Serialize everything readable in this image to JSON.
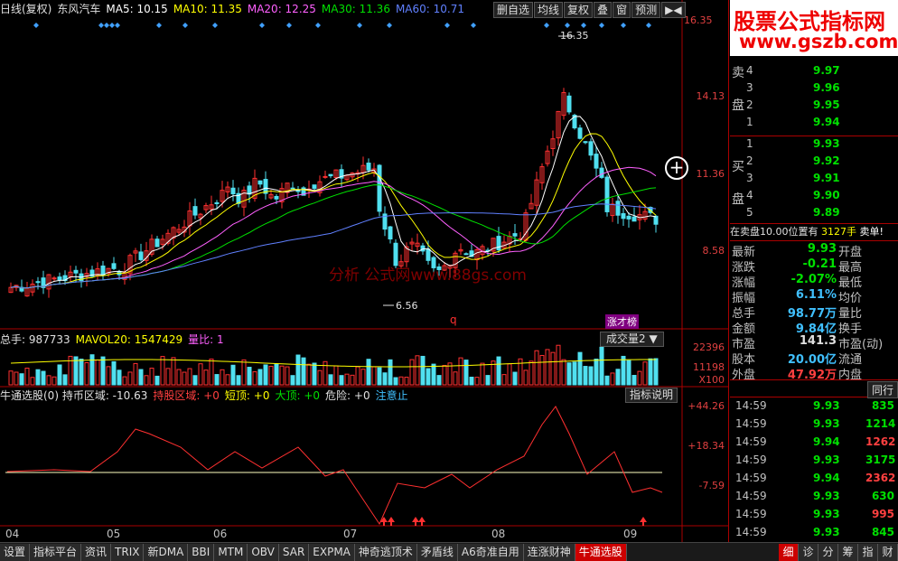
{
  "header": {
    "period": "日线(复权)",
    "stock_name": "东风汽车",
    "ma5": "MA5: 10.15",
    "ma10": "MA10: 11.35",
    "ma20": "MA20: 12.25",
    "ma30": "MA30: 11.36",
    "ma60": "MA60: 10.71"
  },
  "toolbar": [
    "删自选",
    "均线",
    "复权",
    "叠",
    "窗",
    "预测"
  ],
  "price_axis": [
    "16.35",
    "14.13",
    "11.36",
    "8.58"
  ],
  "annotations": {
    "high": "16.35",
    "low": "6.56",
    "watermark": "分析 公式网www.88gs.com",
    "zhangjibang": "涨才榜",
    "q_label": "q"
  },
  "volume_panel": {
    "title": "总手: 987733",
    "mavol": "MAVOL20: 1547429",
    "ratio": "量比: 1",
    "selector": "成交量2",
    "axis": [
      "22396",
      "11198",
      "X100"
    ]
  },
  "indicator_panel": {
    "title": "牛通选股(0) 持币区域: -10.63",
    "hold": "持股区域: +0",
    "short_top": "短顶: +0",
    "big_top": "大顶: +0",
    "danger": "危险: +0",
    "attention": "注意止",
    "help": "指标说明",
    "axis": [
      "+44.26",
      "+18.34",
      "-7.59"
    ]
  },
  "x_labels": [
    "04",
    "05",
    "06",
    "07",
    "08",
    "09"
  ],
  "logo": {
    "line1": "股票公式指标网",
    "line2": "www.gszb.com"
  },
  "order_book": {
    "sell_label": "卖盘",
    "buy_label": "买盘",
    "sell": [
      {
        "lvl": "4",
        "price": "9.97"
      },
      {
        "lvl": "3",
        "price": "9.96"
      },
      {
        "lvl": "2",
        "price": "9.95"
      },
      {
        "lvl": "1",
        "price": "9.94"
      }
    ],
    "buy": [
      {
        "lvl": "1",
        "price": "9.93"
      },
      {
        "lvl": "2",
        "price": "9.92"
      },
      {
        "lvl": "3",
        "price": "9.91"
      },
      {
        "lvl": "4",
        "price": "9.90"
      },
      {
        "lvl": "5",
        "price": "9.89"
      }
    ],
    "notice": "在卖盘10.00位置有",
    "notice_vol": "3127手",
    "notice_tag": "卖单!"
  },
  "quote": [
    {
      "k": "最新",
      "v": "9.93",
      "k2": "开盘",
      "c": "#00e000"
    },
    {
      "k": "涨跌",
      "v": "-0.21",
      "k2": "最高",
      "c": "#00e000"
    },
    {
      "k": "涨幅",
      "v": "-2.07%",
      "k2": "最低",
      "c": "#00e000"
    },
    {
      "k": "振幅",
      "v": "6.11%",
      "k2": "均价",
      "c": "#40c0ff"
    },
    {
      "k": "总手",
      "v": "98.77万",
      "k2": "量比",
      "c": "#40c0ff"
    },
    {
      "k": "金额",
      "v": "9.84亿",
      "k2": "换手",
      "c": "#40c0ff"
    },
    {
      "k": "市盈",
      "v": "141.3",
      "k2": "市盈(动)",
      "c": "#e0e0e0"
    },
    {
      "k": "股本",
      "v": "20.00亿",
      "k2": "流通",
      "c": "#40c0ff"
    },
    {
      "k": "外盘",
      "v": "47.92万",
      "k2": "内盘",
      "c": "#ff4040"
    }
  ],
  "ticks_header": "同行",
  "ticks": [
    {
      "t": "14:59",
      "p": "9.93",
      "v": "835",
      "c": "#00e000"
    },
    {
      "t": "14:59",
      "p": "9.93",
      "v": "1214",
      "c": "#00e000"
    },
    {
      "t": "14:59",
      "p": "9.94",
      "v": "1262",
      "c": "#ff4040"
    },
    {
      "t": "14:59",
      "p": "9.93",
      "v": "3175",
      "c": "#00e000"
    },
    {
      "t": "14:59",
      "p": "9.94",
      "v": "2362",
      "c": "#ff4040"
    },
    {
      "t": "14:59",
      "p": "9.93",
      "v": "630",
      "c": "#00e000"
    },
    {
      "t": "14:59",
      "p": "9.93",
      "v": "995",
      "c": "#ff4040"
    },
    {
      "t": "14:59",
      "p": "9.93",
      "v": "845",
      "c": "#00e000"
    }
  ],
  "bottom_tabs": [
    "设置",
    "指标平台",
    "资讯",
    "TRIX",
    "新DMA",
    "BBI",
    "MTM",
    "OBV",
    "SAR",
    "EXPMA",
    "神奇逃顶术",
    "矛盾线",
    "A6奇准自用",
    "连涨财神",
    "牛通选股"
  ],
  "right_tabs": [
    "细",
    "诊",
    "分",
    "筹",
    "指",
    "财"
  ],
  "colors": {
    "up": "#ff3030",
    "down": "#50e0f0",
    "ma5": "#ffffff",
    "ma10": "#ffff00",
    "ma20": "#ff60ff",
    "ma30": "#00e000",
    "ma60": "#6080ff"
  }
}
